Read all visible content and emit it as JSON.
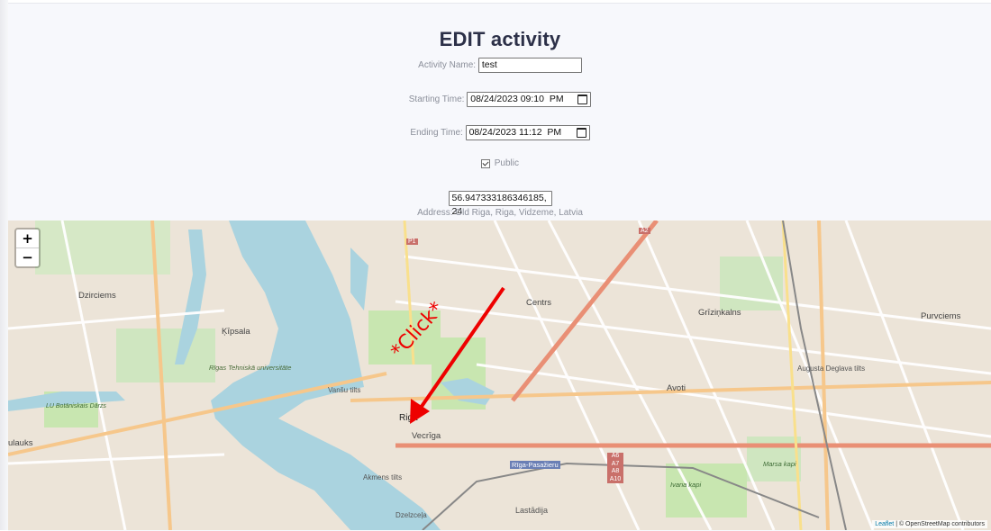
{
  "page": {
    "title": "EDIT activity"
  },
  "form": {
    "activity_name": {
      "label": "Activity Name:",
      "value": "test"
    },
    "starting_time": {
      "label": "Starting Time:",
      "value": "08/24/2023 09:10  PM"
    },
    "ending_time": {
      "label": "Ending Time:",
      "value": "08/24/2023 11:12  PM"
    },
    "public": {
      "label": "Public",
      "checked": true
    },
    "coordinates": {
      "value": "56.947333186346185, 24"
    },
    "address": "Address: Old Riga, Riga, Vidzeme, Latvia"
  },
  "map": {
    "zoom_in": "+",
    "zoom_out": "−",
    "attribution_link": "Leaflet",
    "attribution_text": " | © OpenStreetMap contributors",
    "labels": {
      "dzirciems": "Dzirciems",
      "kipsala": "Ķīpsala",
      "rigas_tehniska": "Rīgas Tehniskā universitāte",
      "vansu_tilts": "Vanšu tilts",
      "riga": "Riga",
      "vecriga": "Vecrīga",
      "centrs": "Centrs",
      "avoti": "Avoti",
      "grizinkalns": "Grīziņkalns",
      "purvciems": "Purvciems",
      "augusta_deglava": "Augusta Deglava tilts",
      "akmens_tilts": "Akmens tilts",
      "dzelzcela": "Dzelzceļa",
      "lastadija": "Lastādija",
      "riga_pasazieru": "Rīga-Pasažieru",
      "ivana_kapi": "Ivana kapi",
      "marsa_kapi": "Marsa kapi",
      "ulauks": "ulauks",
      "lu_botaniskais": "LU Botāniskais Dārzs",
      "p1": "P1",
      "a2": "A2",
      "a6": "A6",
      "a7": "A7",
      "a8": "A8",
      "a10": "A10"
    },
    "annotation": "*Click*",
    "annotation_color": "#ee0000",
    "water_color": "#aad3df",
    "park_color": "#c8e6b0"
  }
}
